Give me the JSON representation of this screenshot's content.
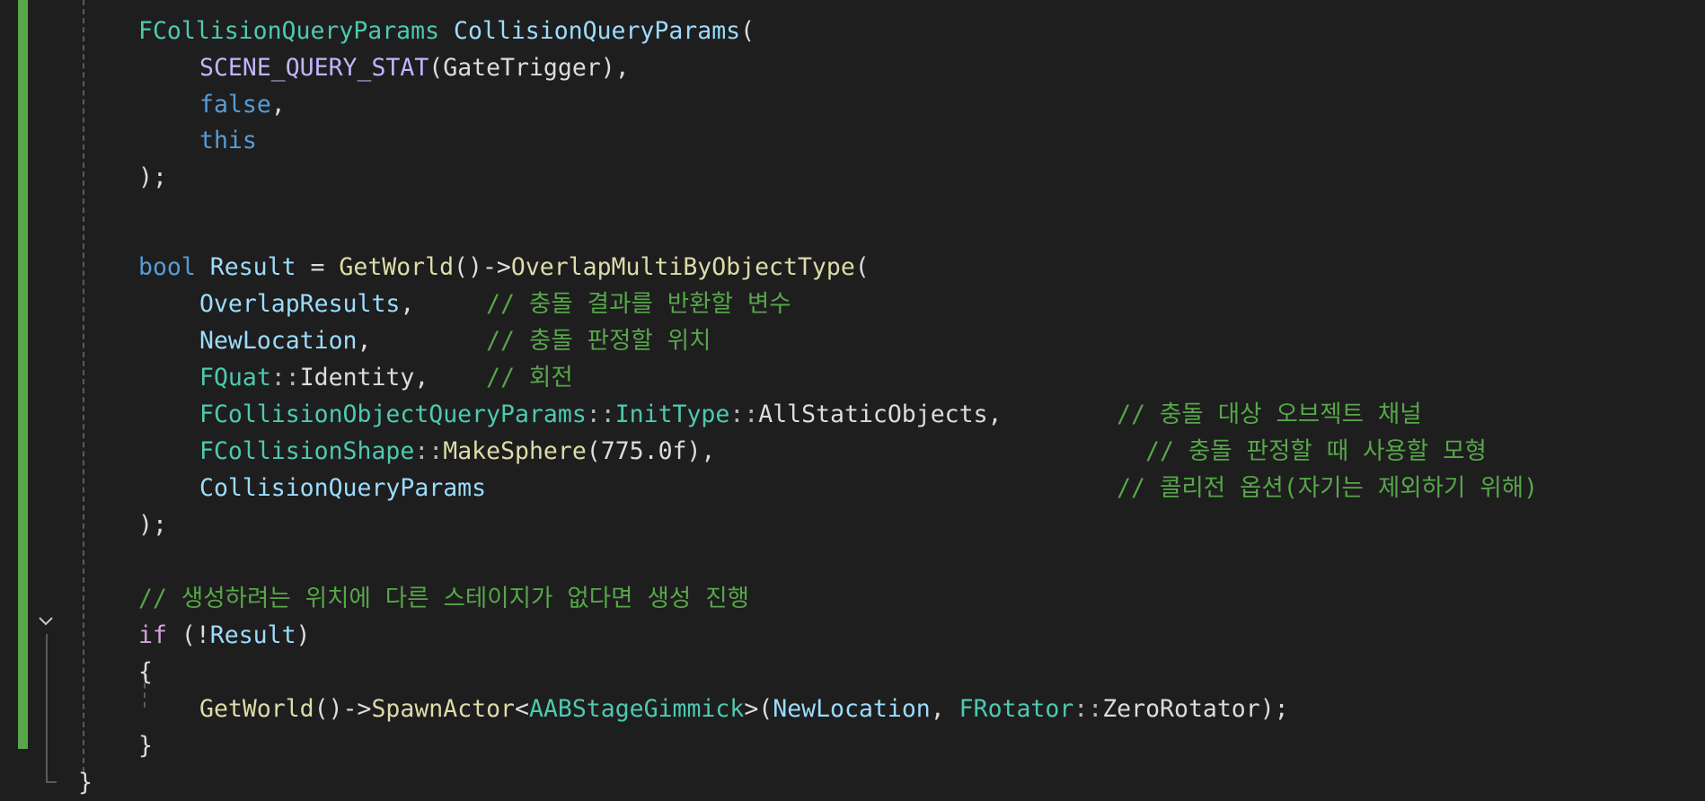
{
  "editor": {
    "colors": {
      "background": "#1e1e1e",
      "change_bar": "#57a64a",
      "type": "#4ec9b0",
      "variable": "#9cdcfe",
      "function": "#dcdcaa",
      "keyword": "#569cd6",
      "control": "#d8a0df",
      "macro": "#beb7ff",
      "comment": "#57a64a",
      "number": "#b5cea8",
      "text": "#dcdcdc"
    },
    "fold_icon": "chevron-down-icon",
    "lines": [
      {
        "tokens": [
          {
            "t": "FCollisionQueryParams",
            "c": "type"
          },
          {
            "t": " ",
            "c": "plain"
          },
          {
            "t": "CollisionQueryParams",
            "c": "var"
          },
          {
            "t": "(",
            "c": "plain"
          }
        ]
      },
      {
        "tokens": [
          {
            "t": "SCENE_QUERY_STAT",
            "c": "macro"
          },
          {
            "t": "(GateTrigger),",
            "c": "plain"
          }
        ]
      },
      {
        "tokens": [
          {
            "t": "false",
            "c": "kw"
          },
          {
            "t": ",",
            "c": "plain"
          }
        ]
      },
      {
        "tokens": [
          {
            "t": "this",
            "c": "kw"
          }
        ]
      },
      {
        "tokens": [
          {
            "t": ");",
            "c": "plain"
          }
        ]
      },
      {
        "tokens": []
      },
      {
        "tokens": [
          {
            "t": "bool",
            "c": "kw"
          },
          {
            "t": " ",
            "c": "plain"
          },
          {
            "t": "Result",
            "c": "var"
          },
          {
            "t": " = ",
            "c": "plain"
          },
          {
            "t": "GetWorld",
            "c": "func"
          },
          {
            "t": "()->",
            "c": "plain"
          },
          {
            "t": "OverlapMultiByObjectType",
            "c": "func"
          },
          {
            "t": "(",
            "c": "plain"
          }
        ]
      },
      {
        "tokens": [
          {
            "t": "OverlapResults",
            "c": "var"
          },
          {
            "t": ",     ",
            "c": "plain"
          },
          {
            "t": "// 충돌 결과를 반환할 변수",
            "c": "cmt"
          }
        ]
      },
      {
        "tokens": [
          {
            "t": "NewLocation",
            "c": "var"
          },
          {
            "t": ",        ",
            "c": "plain"
          },
          {
            "t": "// 충돌 판정할 위치",
            "c": "cmt"
          }
        ]
      },
      {
        "tokens": [
          {
            "t": "FQuat",
            "c": "type"
          },
          {
            "t": "::",
            "c": "punc"
          },
          {
            "t": "Identity",
            "c": "plain"
          },
          {
            "t": ",    ",
            "c": "plain"
          },
          {
            "t": "// 회전",
            "c": "cmt"
          }
        ]
      },
      {
        "tokens": [
          {
            "t": "FCollisionObjectQueryParams",
            "c": "type"
          },
          {
            "t": "::",
            "c": "punc"
          },
          {
            "t": "InitType",
            "c": "type"
          },
          {
            "t": "::",
            "c": "punc"
          },
          {
            "t": "AllStaticObjects",
            "c": "plain"
          },
          {
            "t": ",        ",
            "c": "plain"
          },
          {
            "t": "// 충돌 대상 오브젝트 채널",
            "c": "cmt"
          }
        ]
      },
      {
        "tokens": [
          {
            "t": "FCollisionShape",
            "c": "type"
          },
          {
            "t": "::",
            "c": "punc"
          },
          {
            "t": "MakeSphere",
            "c": "func"
          },
          {
            "t": "(775.0f),",
            "c": "plain"
          },
          {
            "t": "                              ",
            "c": "plain"
          },
          {
            "t": "// 충돌 판정할 때 사용할 모형",
            "c": "cmt"
          }
        ]
      },
      {
        "tokens": [
          {
            "t": "CollisionQueryParams",
            "c": "var"
          },
          {
            "t": "                                            ",
            "c": "plain"
          },
          {
            "t": "// 콜리전 옵션(자기는 제외하기 위해)",
            "c": "cmt"
          }
        ]
      },
      {
        "tokens": [
          {
            "t": ");",
            "c": "plain"
          }
        ]
      },
      {
        "tokens": []
      },
      {
        "tokens": [
          {
            "t": "// 생성하려는 위치에 다른 스테이지가 없다면 생성 진행",
            "c": "cmt"
          }
        ]
      },
      {
        "tokens": [
          {
            "t": "if",
            "c": "ctrl"
          },
          {
            "t": " (!",
            "c": "plain"
          },
          {
            "t": "Result",
            "c": "var"
          },
          {
            "t": ")",
            "c": "plain"
          }
        ]
      },
      {
        "tokens": [
          {
            "t": "{",
            "c": "plain"
          }
        ]
      },
      {
        "tokens": [
          {
            "t": "GetWorld",
            "c": "func"
          },
          {
            "t": "()->",
            "c": "plain"
          },
          {
            "t": "SpawnActor",
            "c": "func"
          },
          {
            "t": "<",
            "c": "plain"
          },
          {
            "t": "AABStageGimmick",
            "c": "type"
          },
          {
            "t": ">(",
            "c": "plain"
          },
          {
            "t": "NewLocation",
            "c": "var"
          },
          {
            "t": ", ",
            "c": "plain"
          },
          {
            "t": "FRotator",
            "c": "type"
          },
          {
            "t": "::",
            "c": "punc"
          },
          {
            "t": "ZeroRotator",
            "c": "plain"
          },
          {
            "t": ");",
            "c": "plain"
          }
        ]
      },
      {
        "tokens": [
          {
            "t": "}",
            "c": "plain"
          }
        ]
      },
      {
        "tokens": [
          {
            "t": "}",
            "c": "plain"
          }
        ]
      }
    ]
  }
}
